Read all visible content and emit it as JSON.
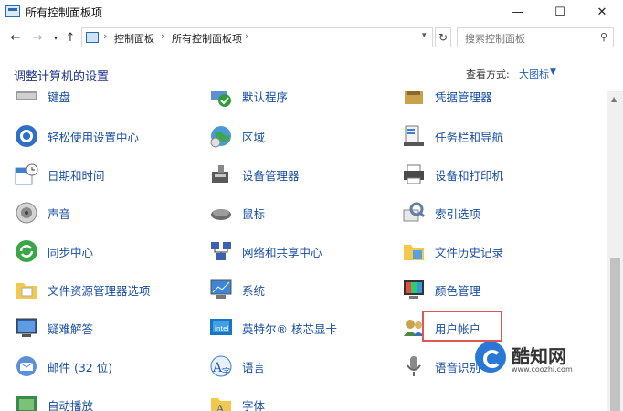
{
  "window": {
    "title": "所有控制面板项",
    "minimize_glyph": "—",
    "maximize_glyph": "☐",
    "close_glyph": "✕"
  },
  "address": {
    "crumbs": [
      "控制面板",
      "所有控制面板项"
    ],
    "search_placeholder": "搜索控制面板"
  },
  "header": {
    "title": "调整计算机的设置",
    "view_by_label": "查看方式:",
    "view_by_value": "大图标"
  },
  "items": [
    {
      "label": "键盘",
      "icon": "keyboard-icon"
    },
    {
      "label": "默认程序",
      "icon": "default-programs-icon"
    },
    {
      "label": "凭据管理器",
      "icon": "credential-manager-icon"
    },
    {
      "label": "轻松使用设置中心",
      "icon": "ease-of-access-icon"
    },
    {
      "label": "区域",
      "icon": "region-icon"
    },
    {
      "label": "任务栏和导航",
      "icon": "taskbar-icon"
    },
    {
      "label": "日期和时间",
      "icon": "date-time-icon"
    },
    {
      "label": "设备管理器",
      "icon": "device-manager-icon"
    },
    {
      "label": "设备和打印机",
      "icon": "printer-icon"
    },
    {
      "label": "声音",
      "icon": "sound-icon"
    },
    {
      "label": "鼠标",
      "icon": "mouse-icon"
    },
    {
      "label": "索引选项",
      "icon": "indexing-icon"
    },
    {
      "label": "同步中心",
      "icon": "sync-center-icon"
    },
    {
      "label": "网络和共享中心",
      "icon": "network-icon"
    },
    {
      "label": "文件历史记录",
      "icon": "file-history-icon"
    },
    {
      "label": "文件资源管理器选项",
      "icon": "folder-options-icon"
    },
    {
      "label": "系统",
      "icon": "system-icon"
    },
    {
      "label": "颜色管理",
      "icon": "color-management-icon"
    },
    {
      "label": "疑难解答",
      "icon": "troubleshooting-icon"
    },
    {
      "label": "英特尔® 核芯显卡",
      "icon": "intel-graphics-icon"
    },
    {
      "label": "用户帐户",
      "icon": "user-accounts-icon"
    },
    {
      "label": "邮件 (32 位)",
      "icon": "mail-icon"
    },
    {
      "label": "语言",
      "icon": "language-icon"
    },
    {
      "label": "语音识别",
      "icon": "speech-recognition-icon"
    },
    {
      "label": "自动播放",
      "icon": "autoplay-icon"
    },
    {
      "label": "字体",
      "icon": "fonts-icon"
    }
  ],
  "watermark": {
    "brand": "酷知网",
    "url": "www.coozhi.com"
  },
  "colors": {
    "link": "#1a4fa0",
    "heading": "#1e3287",
    "highlight_border": "#e05555"
  }
}
